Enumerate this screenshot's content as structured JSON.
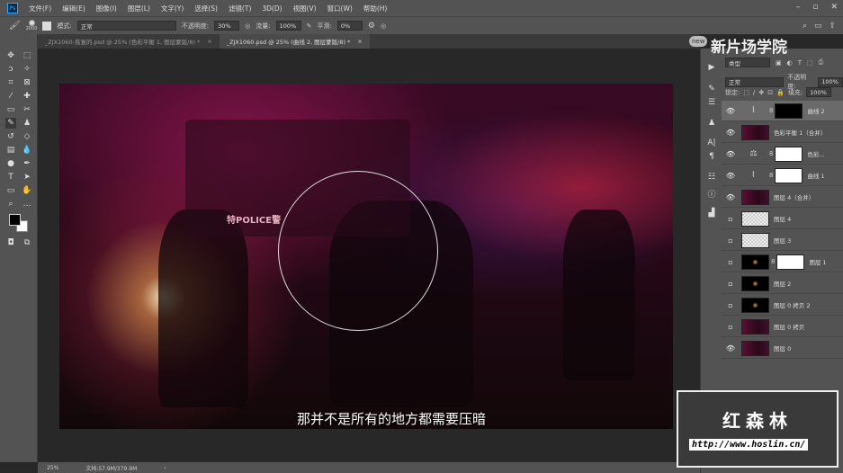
{
  "app": {
    "logo": "Ps"
  },
  "menu": [
    "文件(F)",
    "编辑(E)",
    "图像(I)",
    "图层(L)",
    "文字(Y)",
    "选择(S)",
    "滤镜(T)",
    "3D(D)",
    "视图(V)",
    "窗口(W)",
    "帮助(H)"
  ],
  "window_controls": {
    "minimize": "–",
    "maximize": "▫",
    "close": "✕"
  },
  "options": {
    "brush_size": "2000",
    "mode_label": "模式:",
    "mode_value": "正常",
    "opacity_label": "不透明度:",
    "opacity_value": "30%",
    "flow_label": "流量:",
    "flow_value": "100%",
    "smooth_label": "平滑:",
    "smooth_value": "0%"
  },
  "tabs": [
    {
      "label": "_ZJX1060-恢复的.psd @ 25% (色彩平衡 1, 图层蒙版/8) *",
      "close": "×"
    },
    {
      "label": "_ZJX1060.psd @ 25% (曲线 2, 图层蒙版/8) *",
      "close": "×"
    }
  ],
  "canvas": {
    "subtitle": "那并不是所有的地方都需要压暗",
    "vehicle_text": "特POLICE警"
  },
  "status": {
    "zoom": "25%",
    "doc": "文档:57.9M/379.9M",
    "arrow": "›"
  },
  "layers_panel": {
    "filter": "类型",
    "blend": "正常",
    "opacity_label": "不透明度:",
    "opacity": "100%",
    "lock_label": "锁定:",
    "fill_label": "填充:",
    "fill": "100%",
    "layers": [
      {
        "name": "曲线 2",
        "visible": true,
        "kind": "curves",
        "mask": "black",
        "selected": true
      },
      {
        "name": "色彩平衡 1（合并）",
        "visible": true,
        "kind": "photo"
      },
      {
        "name": "色彩...",
        "visible": true,
        "kind": "balance",
        "mask": "white"
      },
      {
        "name": "曲线 1",
        "visible": true,
        "kind": "curves",
        "mask": "white"
      },
      {
        "name": "图层 4（合并）",
        "visible": true,
        "kind": "photo"
      },
      {
        "name": "图层 4",
        "visible": false,
        "kind": "trans"
      },
      {
        "name": "图层 3",
        "visible": false,
        "kind": "trans"
      },
      {
        "name": "图层 1",
        "visible": false,
        "kind": "dark",
        "mask": "white"
      },
      {
        "name": "图层 2",
        "visible": false,
        "kind": "dark"
      },
      {
        "name": "图层 0 拷贝 2",
        "visible": false,
        "kind": "dark"
      },
      {
        "name": "图层 0 拷贝",
        "visible": false,
        "kind": "photo"
      },
      {
        "name": "图层 0",
        "visible": true,
        "kind": "photo"
      }
    ]
  },
  "watermarks": {
    "school": "新片场学院",
    "new": "new",
    "author": "红森林",
    "url": "http://www.hoslin.cn/"
  }
}
